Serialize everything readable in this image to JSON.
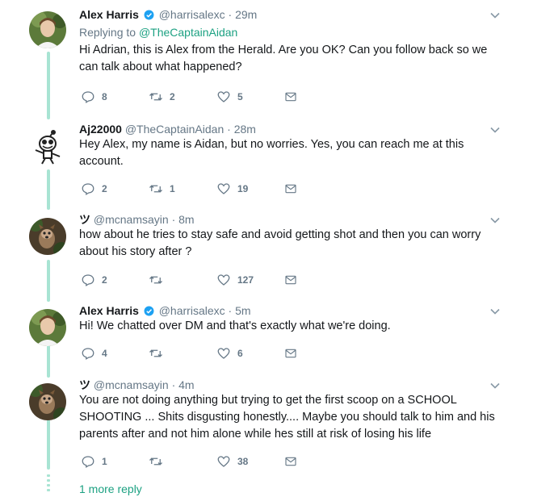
{
  "tweets": [
    {
      "name": "Alex Harris",
      "verified": true,
      "handle": "@harrisalexc",
      "time": "29m",
      "replying_prefix": "Replying to ",
      "replying_to": "@TheCaptainAidan",
      "text": "Hi Adrian, this is Alex from the Herald. Are you OK? Can you follow back so we can talk about what happened?",
      "replies": "8",
      "retweets": "2",
      "likes": "5",
      "avatar": "woman-avatar"
    },
    {
      "name": "Aj22000",
      "verified": false,
      "handle": "@TheCaptainAidan",
      "time": "28m",
      "text": "Hey Alex, my name is Aidan, but no worries. Yes, you can reach me at this account.",
      "replies": "2",
      "retweets": "1",
      "likes": "19",
      "avatar": "cartoon-avatar"
    },
    {
      "name": "ツ",
      "verified": false,
      "handle": "@mcnamsayin",
      "time": "8m",
      "text": "how about he tries to stay safe and avoid getting shot and then you can worry about his story after ?",
      "replies": "2",
      "retweets": "",
      "likes": "127",
      "avatar": "dog-avatar"
    },
    {
      "name": "Alex Harris",
      "verified": true,
      "handle": "@harrisalexc",
      "time": "5m",
      "text": "Hi! We chatted over DM and that's exactly what we're doing.",
      "replies": "4",
      "retweets": "",
      "likes": "6",
      "avatar": "woman-avatar"
    },
    {
      "name": "ツ",
      "verified": false,
      "handle": "@mcnamsayin",
      "time": "4m",
      "text": "You are not doing anything but trying to get the first scoop on a SCHOOL SHOOTING ... Shits disgusting honestly.... Maybe you should talk to him and his parents after and not him alone while hes still at risk of losing his life",
      "replies": "1",
      "retweets": "",
      "likes": "38",
      "avatar": "dog-avatar"
    }
  ],
  "time_separator": " · ",
  "more_replies": "1 more reply",
  "colors": {
    "accent": "#1ca182",
    "thread_line": "#a8e4d3",
    "muted": "#657786",
    "verified": "#1da1f2"
  }
}
